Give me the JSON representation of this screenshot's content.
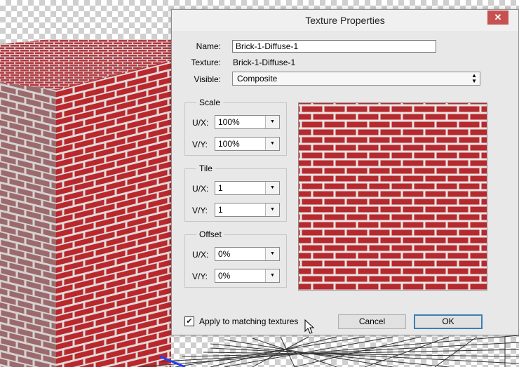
{
  "dialog": {
    "title": "Texture Properties",
    "close_label": "✕",
    "name_label": "Name:",
    "name_value": "Brick-1-Diffuse-1",
    "texture_label": "Texture:",
    "texture_value": "Brick-1-Diffuse-1",
    "visible_label": "Visible:",
    "visible_value": "Composite",
    "groups": [
      {
        "title": "Scale",
        "ux_label": "U/X:",
        "ux_value": "100%",
        "vy_label": "V/Y:",
        "vy_value": "100%"
      },
      {
        "title": "Tile",
        "ux_label": "U/X:",
        "ux_value": "1",
        "vy_label": "V/Y:",
        "vy_value": "1"
      },
      {
        "title": "Offset",
        "ux_label": "U/X:",
        "ux_value": "0%",
        "vy_label": "V/Y:",
        "vy_value": "0%"
      }
    ],
    "apply_label": "Apply to matching textures",
    "apply_checked": "✔",
    "cancel_label": "Cancel",
    "ok_label": "OK"
  },
  "colors": {
    "brick": "#b52a2e",
    "mortar": "#e6dede",
    "dialog_bg": "#e8e8e8",
    "close": "#c75050",
    "default_button_border": "#3c7fb1"
  },
  "icons": [
    "close-icon",
    "chevron-down-icon",
    "checkmark-icon",
    "cursor-arrow-icon"
  ]
}
